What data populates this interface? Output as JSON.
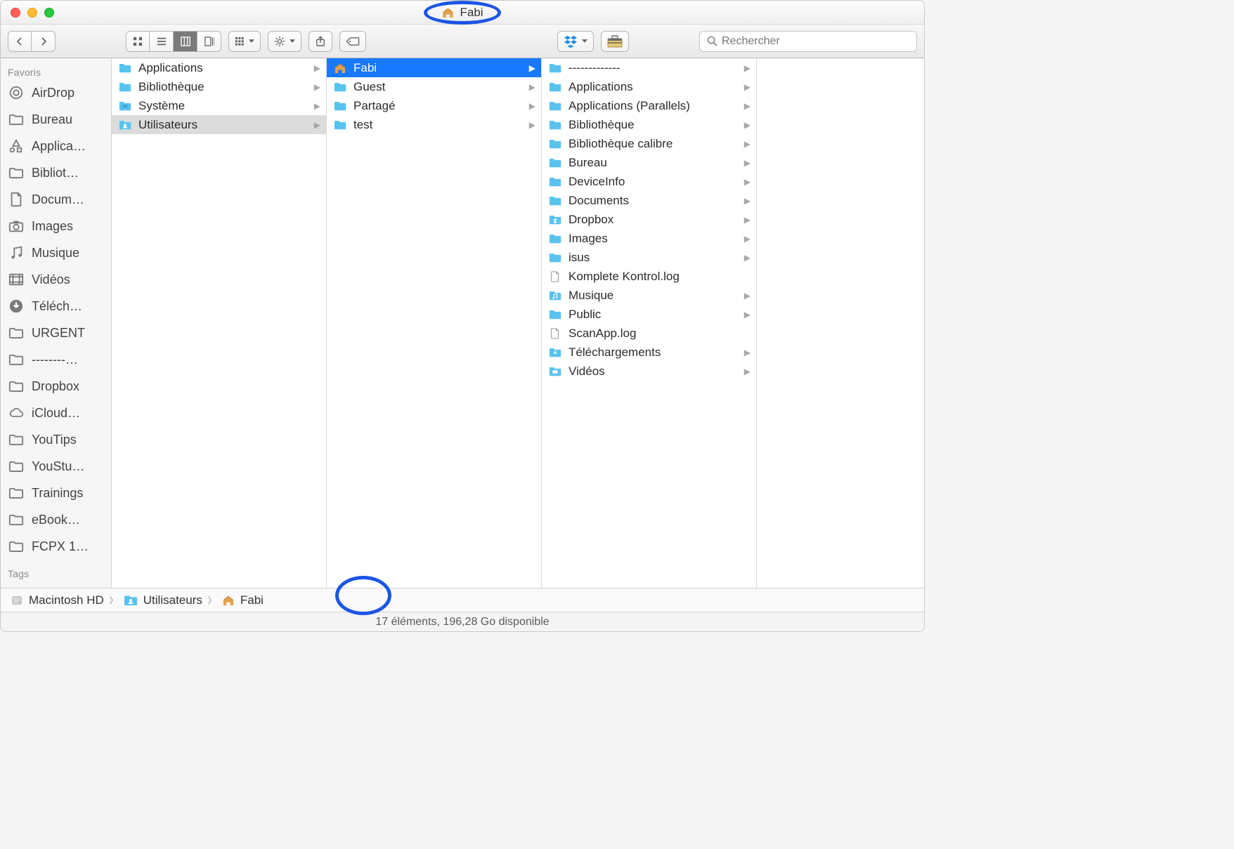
{
  "window": {
    "title": "Fabi"
  },
  "search": {
    "placeholder": "Rechercher"
  },
  "sidebar": {
    "favorites_title": "Favoris",
    "tags_title": "Tags",
    "items": [
      {
        "label": "AirDrop",
        "icon": "airdrop"
      },
      {
        "label": "Bureau",
        "icon": "folder-grey"
      },
      {
        "label": "Applica…",
        "icon": "apps"
      },
      {
        "label": "Bibliot…",
        "icon": "folder-grey"
      },
      {
        "label": "Docum…",
        "icon": "doc"
      },
      {
        "label": "Images",
        "icon": "camera"
      },
      {
        "label": "Musique",
        "icon": "music"
      },
      {
        "label": "Vidéos",
        "icon": "video"
      },
      {
        "label": "Téléch…",
        "icon": "download"
      },
      {
        "label": "URGENT",
        "icon": "folder-grey"
      },
      {
        "label": "--------…",
        "icon": "folder-grey"
      },
      {
        "label": "Dropbox",
        "icon": "folder-grey"
      },
      {
        "label": "iCloud…",
        "icon": "cloud"
      },
      {
        "label": "YouTips",
        "icon": "folder-grey"
      },
      {
        "label": "YouStu…",
        "icon": "folder-grey"
      },
      {
        "label": "Trainings",
        "icon": "folder-grey"
      },
      {
        "label": "eBook…",
        "icon": "folder-grey"
      },
      {
        "label": "FCPX 1…",
        "icon": "folder-grey"
      }
    ]
  },
  "columns": {
    "0": {
      "items": [
        {
          "label": "Applications",
          "icon": "folder",
          "arrow": true
        },
        {
          "label": "Bibliothèque",
          "icon": "folder",
          "arrow": true
        },
        {
          "label": "Système",
          "icon": "folder-x",
          "arrow": true
        },
        {
          "label": "Utilisateurs",
          "icon": "folder-users",
          "arrow": true,
          "selected": "open"
        }
      ]
    },
    "1": {
      "items": [
        {
          "label": "Fabi",
          "icon": "home",
          "arrow": true,
          "selected": "active"
        },
        {
          "label": "Guest",
          "icon": "folder",
          "arrow": true
        },
        {
          "label": "Partagé",
          "icon": "folder",
          "arrow": true
        },
        {
          "label": "test",
          "icon": "folder",
          "arrow": true
        }
      ]
    },
    "2": {
      "items": [
        {
          "label": "-------------",
          "icon": "folder",
          "arrow": true
        },
        {
          "label": "Applications",
          "icon": "folder",
          "arrow": true
        },
        {
          "label": "Applications (Parallels)",
          "icon": "folder",
          "arrow": true
        },
        {
          "label": "Bibliothèque",
          "icon": "folder",
          "arrow": true
        },
        {
          "label": "Bibliothèque calibre",
          "icon": "folder",
          "arrow": true
        },
        {
          "label": "Bureau",
          "icon": "folder",
          "arrow": true
        },
        {
          "label": "DeviceInfo",
          "icon": "folder",
          "arrow": true
        },
        {
          "label": "Documents",
          "icon": "folder",
          "arrow": true
        },
        {
          "label": "Dropbox",
          "icon": "dropbox",
          "arrow": true
        },
        {
          "label": "Images",
          "icon": "folder",
          "arrow": true
        },
        {
          "label": "isus",
          "icon": "folder",
          "arrow": true
        },
        {
          "label": "Komplete Kontrol.log",
          "icon": "file",
          "arrow": false
        },
        {
          "label": "Musique",
          "icon": "folder-music",
          "arrow": true
        },
        {
          "label": "Public",
          "icon": "folder",
          "arrow": true
        },
        {
          "label": "ScanApp.log",
          "icon": "file",
          "arrow": false
        },
        {
          "label": "Téléchargements",
          "icon": "folder-dl",
          "arrow": true
        },
        {
          "label": "Vidéos",
          "icon": "folder-video",
          "arrow": true
        }
      ]
    }
  },
  "pathbar": {
    "crumbs": [
      {
        "label": "Macintosh HD",
        "icon": "hd"
      },
      {
        "label": "Utilisateurs",
        "icon": "folder-users"
      },
      {
        "label": "Fabi",
        "icon": "home"
      }
    ]
  },
  "status": {
    "text": "17 éléments, 196,28 Go disponible"
  }
}
